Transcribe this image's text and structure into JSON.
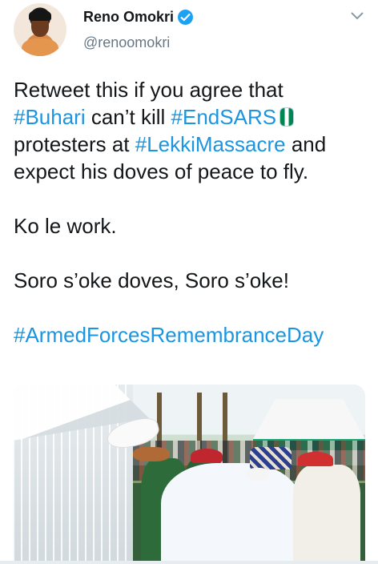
{
  "tweet": {
    "author": {
      "name": "Reno Omokri",
      "handle": "@renoomokri",
      "verified": true
    },
    "body": {
      "line1": "Retweet this if you agree that",
      "line2_tag1": "#Buhari",
      "line2_text": " can’t kill ",
      "line2_tag2": "#EndSARS",
      "line3_text": "protesters at ",
      "line3_tag": "#LekkiMassacre",
      "line3_end": " and",
      "line4": "expect his doves of peace to fly.",
      "line5": "Ko le work.",
      "line6": "Soro s’oke doves, Soro s’oke!",
      "line7_tag": "#ArmedForcesRemembranceDay"
    },
    "emoji": "nigeria-flag-fist",
    "menu_icon": "chevron-down-icon"
  },
  "colors": {
    "link": "#1b95e0",
    "verified": "#1da1f2",
    "secondary_text": "#657786"
  }
}
